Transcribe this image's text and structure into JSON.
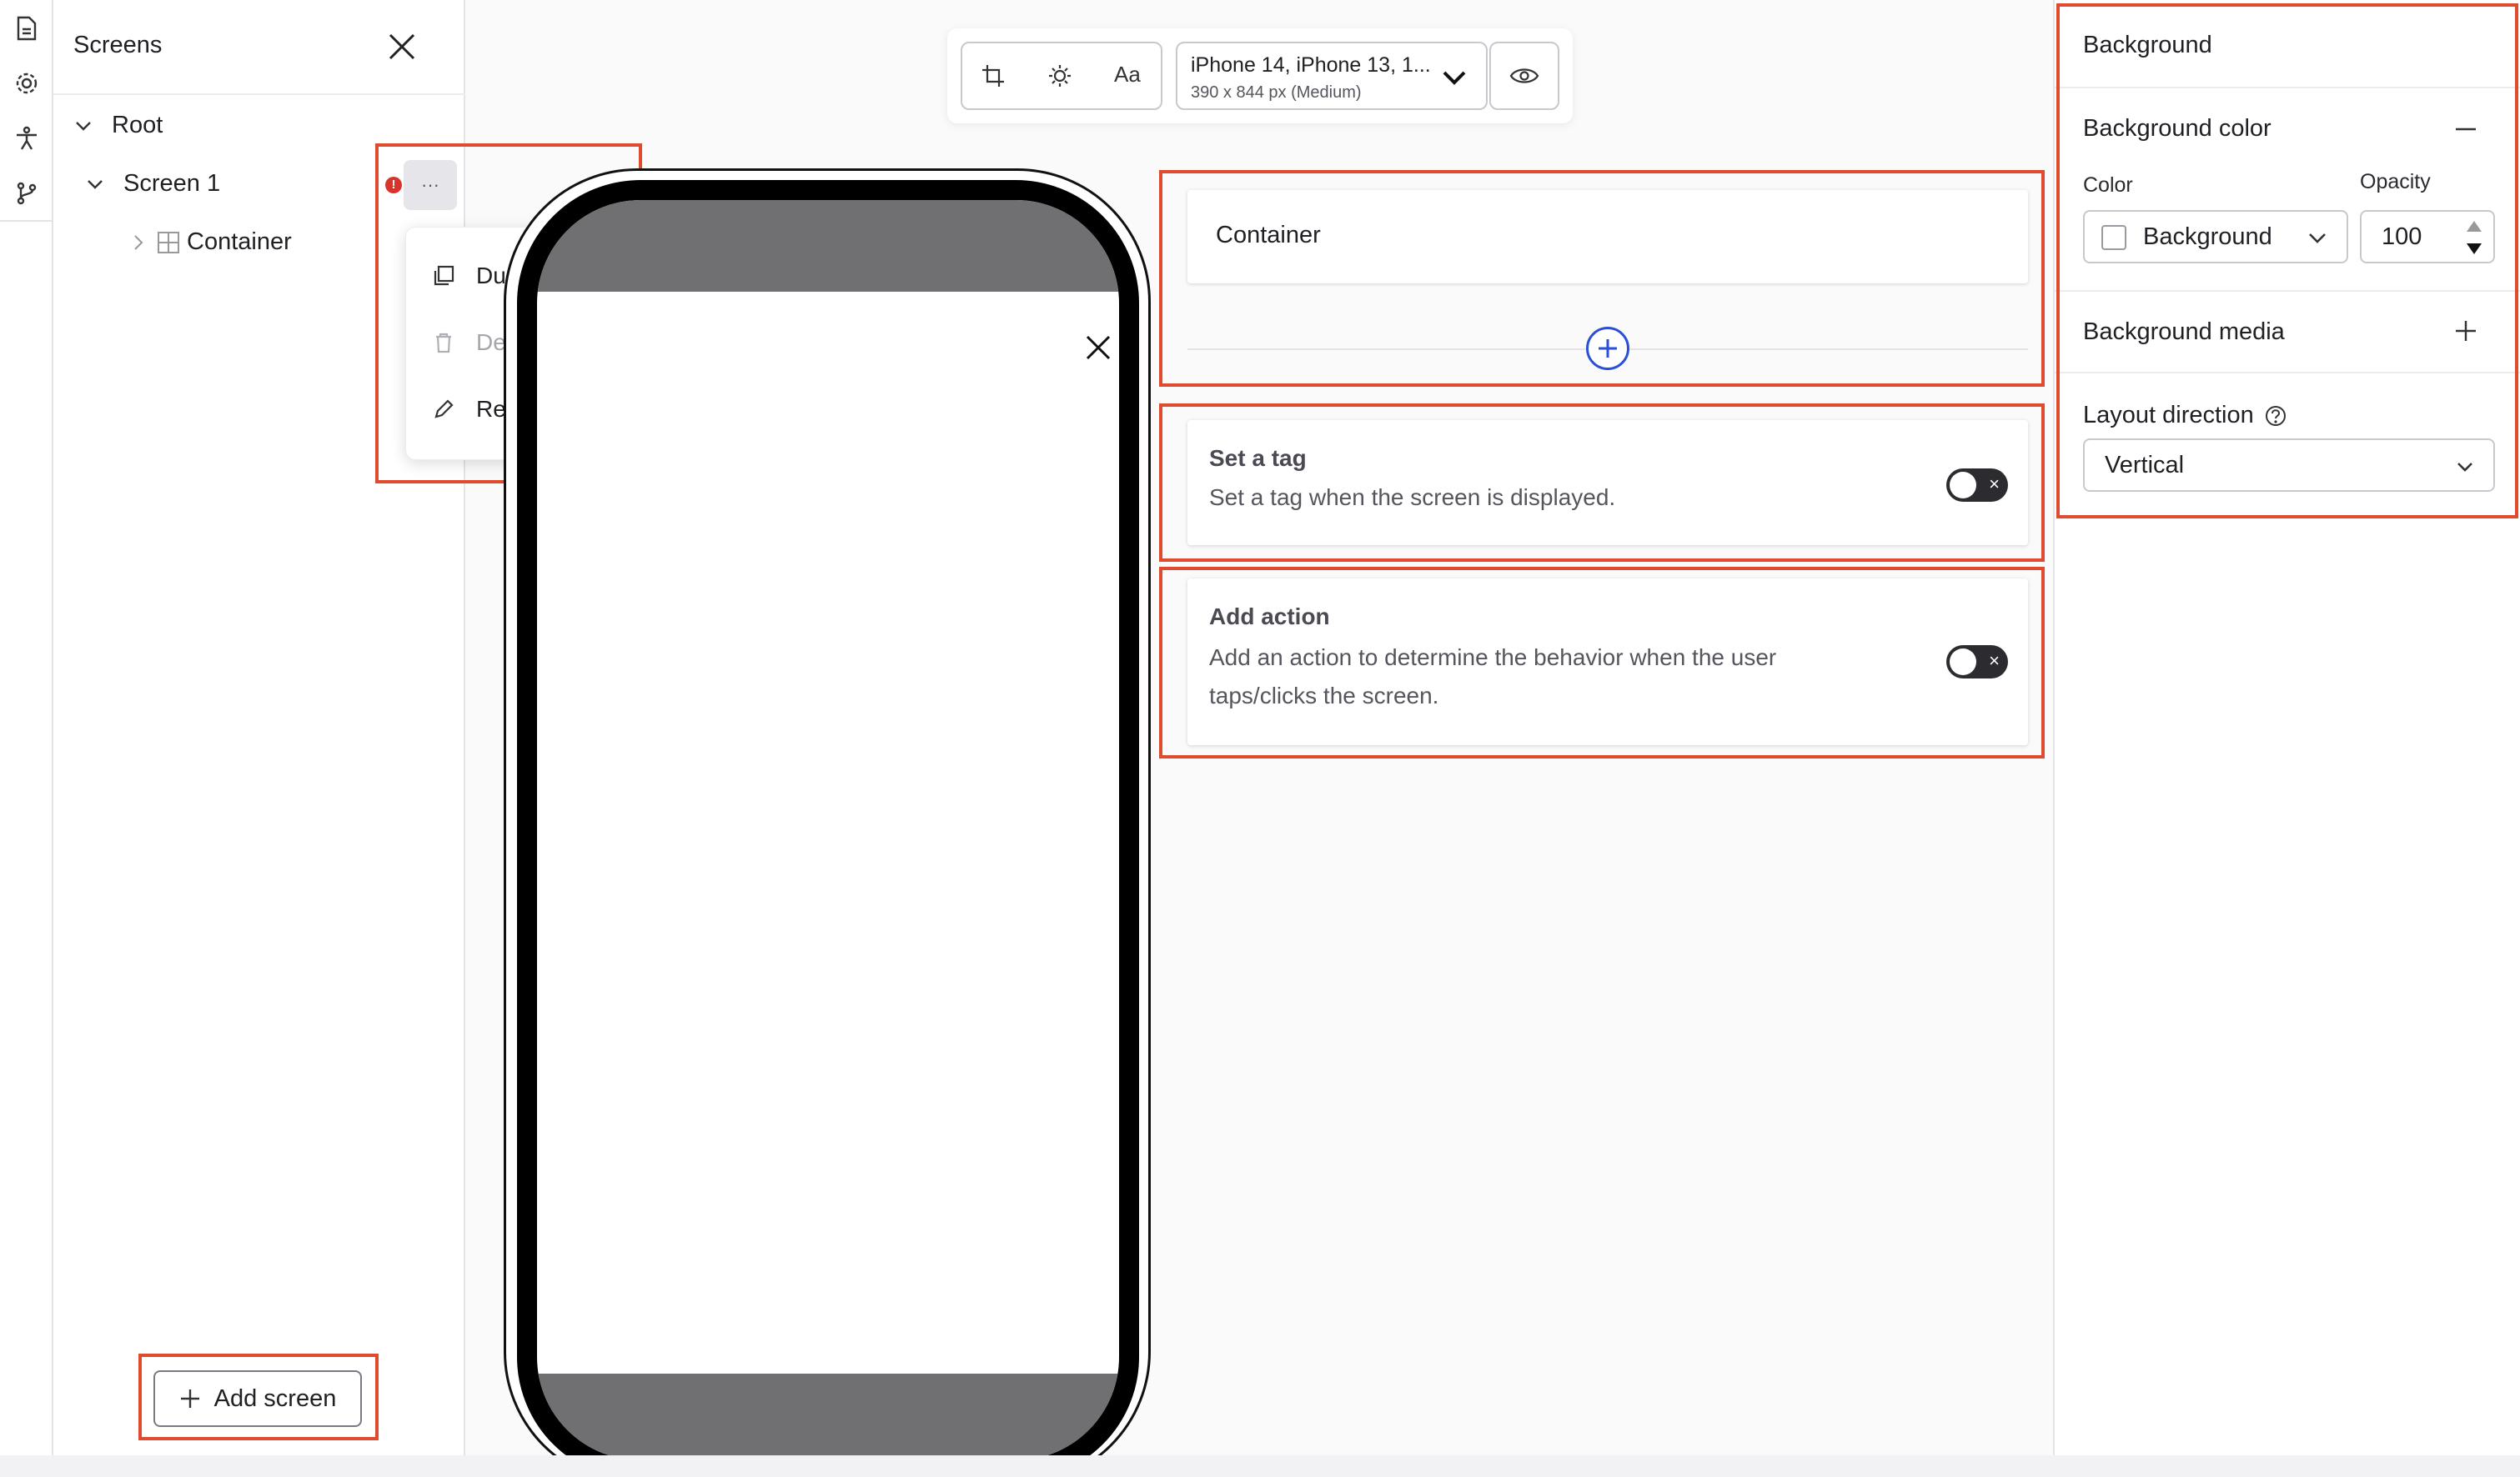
{
  "rail": {
    "icons": [
      "document-icon",
      "gear-icon",
      "accessibility-icon",
      "branch-icon"
    ]
  },
  "screens_panel": {
    "title": "Screens",
    "tree": {
      "root_label": "Root",
      "screen_label": "Screen 1",
      "container_label": "Container"
    },
    "more_label": "···",
    "menu": {
      "duplicate": "Duplicate",
      "delete": "Delete",
      "rename": "Rename"
    },
    "add_screen_label": "Add screen"
  },
  "toolbar": {
    "font_label": "Aa",
    "device_name": "iPhone 14, iPhone 13, 1...",
    "device_size": "390 x 844 px (Medium)"
  },
  "center": {
    "container_label": "Container",
    "tag_card": {
      "title": "Set a tag",
      "description": "Set a tag when the screen is displayed."
    },
    "action_card": {
      "title": "Add action",
      "description_line1": "Add an action to determine the behavior when the user",
      "description_line2": "taps/clicks the screen."
    },
    "toggle_off_symbol": "×"
  },
  "right_panel": {
    "section_title": "Background",
    "bg_color_title": "Background color",
    "color_label": "Color",
    "opacity_label": "Opacity",
    "color_value": "Background",
    "opacity_value": "100",
    "bg_media_title": "Background media",
    "layout_direction_title": "Layout direction",
    "layout_direction_value": "Vertical"
  },
  "colors": {
    "highlight": "#e04a2f",
    "accent_blue": "#2a4fd8",
    "error_red": "#d8342c",
    "phone_bar": "#707072"
  }
}
